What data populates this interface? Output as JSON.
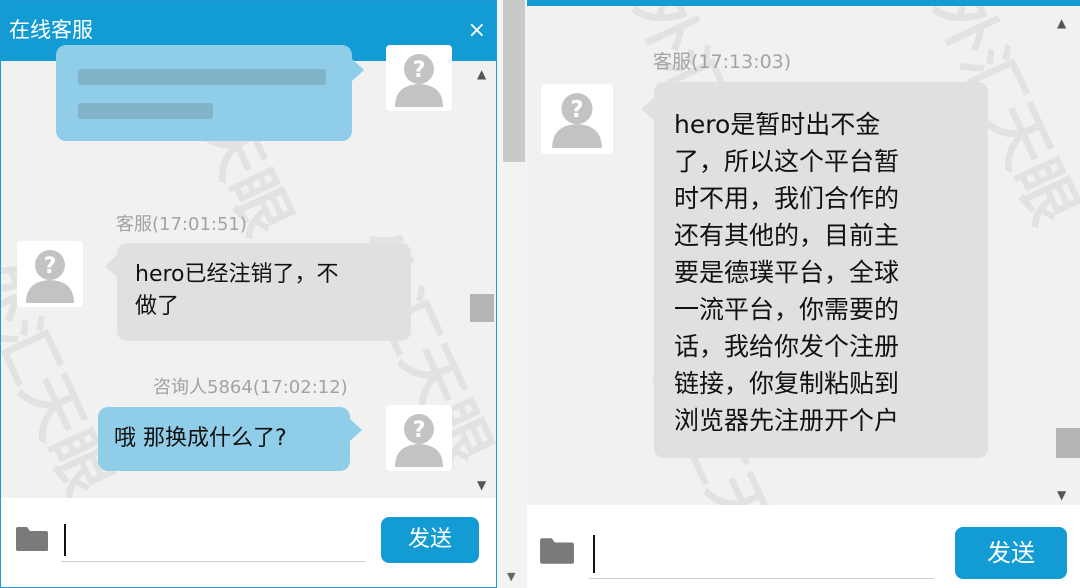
{
  "left_window": {
    "title": "在线客服",
    "close_glyph": "×",
    "messages": [
      {
        "sender": "客服",
        "time": "(17:01:51)",
        "text": "hero已经注销了，不\n做了"
      },
      {
        "sender": "咨询人5864",
        "time": "(17:02:12)",
        "text": "哦 那换成什么了?"
      }
    ],
    "input_placeholder": "",
    "send_label": "发送"
  },
  "right_window": {
    "messages": [
      {
        "sender": "客服",
        "time": "(17:13:03)",
        "text": "hero是暂时出不金\n了，所以这个平台暂\n时不用，我们合作的\n还有其他的，目前主\n要是德璞平台，全球\n一流平台，你需要的\n话，我给你发个注册\n链接，你复制粘贴到\n浏览器先注册开个户"
      }
    ],
    "input_placeholder": "",
    "send_label": "发送"
  },
  "watermark": "外汇天眼",
  "icons": {
    "avatar": "user-avatar-icon",
    "folder": "folder-icon",
    "scroll_up": "scroll-up-icon",
    "scroll_down": "scroll-down-icon"
  },
  "colors": {
    "accent": "#139bd3",
    "customer_bubble": "#8fcde8",
    "agent_bubble": "#e0e0e0",
    "chat_background": "#f1f1f1"
  }
}
